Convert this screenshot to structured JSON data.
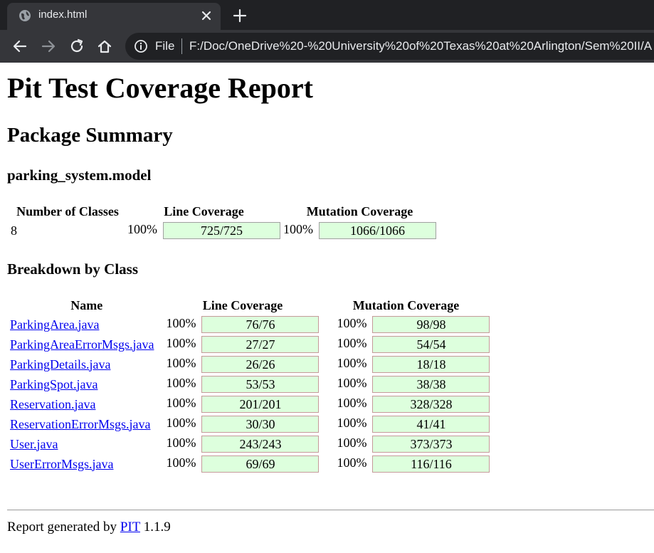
{
  "browser": {
    "tab_title": "index.html",
    "scheme_label": "File",
    "url": "F:/Doc/OneDrive%20-%20University%20of%20Texas%20at%20Arlington/Sem%20II/A"
  },
  "report": {
    "title": "Pit Test Coverage Report",
    "summary_heading": "Package Summary",
    "package_name": "parking_system.model",
    "package_table": {
      "headers": [
        "Number of Classes",
        "Line Coverage",
        "Mutation Coverage"
      ],
      "classes": "8",
      "line_pct": "100%",
      "line_value": "725/725",
      "line_fraction": 1.0,
      "mutation_pct": "100%",
      "mutation_value": "1066/1066",
      "mutation_fraction": 1.0
    },
    "breakdown_heading": "Breakdown by Class",
    "class_table": {
      "headers": [
        "Name",
        "Line Coverage",
        "Mutation Coverage"
      ],
      "rows": [
        {
          "name": "ParkingArea.java",
          "line_pct": "100%",
          "line": "76/76",
          "mut_pct": "100%",
          "mut": "98/98"
        },
        {
          "name": "ParkingAreaErrorMsgs.java",
          "line_pct": "100%",
          "line": "27/27",
          "mut_pct": "100%",
          "mut": "54/54"
        },
        {
          "name": "ParkingDetails.java",
          "line_pct": "100%",
          "line": "26/26",
          "mut_pct": "100%",
          "mut": "18/18"
        },
        {
          "name": "ParkingSpot.java",
          "line_pct": "100%",
          "line": "53/53",
          "mut_pct": "100%",
          "mut": "38/38"
        },
        {
          "name": "Reservation.java",
          "line_pct": "100%",
          "line": "201/201",
          "mut_pct": "100%",
          "mut": "328/328"
        },
        {
          "name": "ReservationErrorMsgs.java",
          "line_pct": "100%",
          "line": "30/30",
          "mut_pct": "100%",
          "mut": "41/41"
        },
        {
          "name": "User.java",
          "line_pct": "100%",
          "line": "243/243",
          "mut_pct": "100%",
          "mut": "373/373"
        },
        {
          "name": "UserErrorMsgs.java",
          "line_pct": "100%",
          "line": "69/69",
          "mut_pct": "100%",
          "mut": "116/116"
        }
      ]
    },
    "footer": {
      "prefix": "Report generated by ",
      "link": "PIT",
      "suffix": " 1.1.9"
    },
    "colors": {
      "coverage_fill": "#ddffdd",
      "link": "#0000ee"
    }
  }
}
